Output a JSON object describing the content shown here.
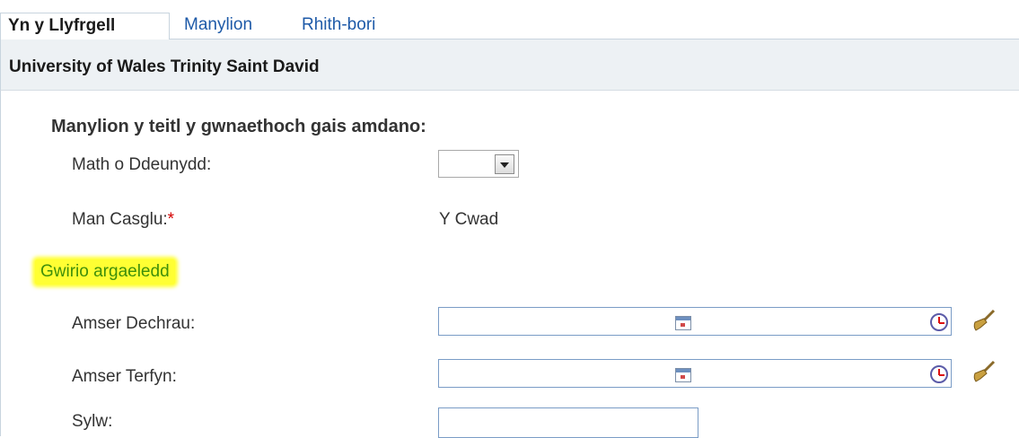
{
  "tabs": [
    {
      "label": "Yn y Llyfrgell",
      "active": true
    },
    {
      "label": "Manylion",
      "active": false
    },
    {
      "label": "Rhith-bori",
      "active": false
    }
  ],
  "header": {
    "title": "University of Wales Trinity Saint David"
  },
  "form": {
    "section_title": "Manylion y teitl y gwnaethoch gais amdano:",
    "material_type": {
      "label": "Math o Ddeunydd:",
      "value": ""
    },
    "pickup": {
      "label": "Man Casglu:",
      "required_marker": "*",
      "value": "Y Cwad"
    },
    "availability_link": "Gwirio argaeledd",
    "start_time": {
      "label": "Amser Dechrau:",
      "value": ""
    },
    "end_time": {
      "label": "Amser Terfyn:",
      "value": ""
    },
    "note": {
      "label": "Sylw:",
      "value": ""
    }
  },
  "icons": {
    "dropdown": "chevron-down-icon",
    "calendar": "calendar-icon",
    "clock": "clock-icon",
    "clear": "broom-icon"
  },
  "colors": {
    "tab_link": "#1e5aa8",
    "header_bg": "#edf1f4",
    "highlight": "#ffff33",
    "link_green": "#3f8f0a",
    "required": "#d40000"
  }
}
